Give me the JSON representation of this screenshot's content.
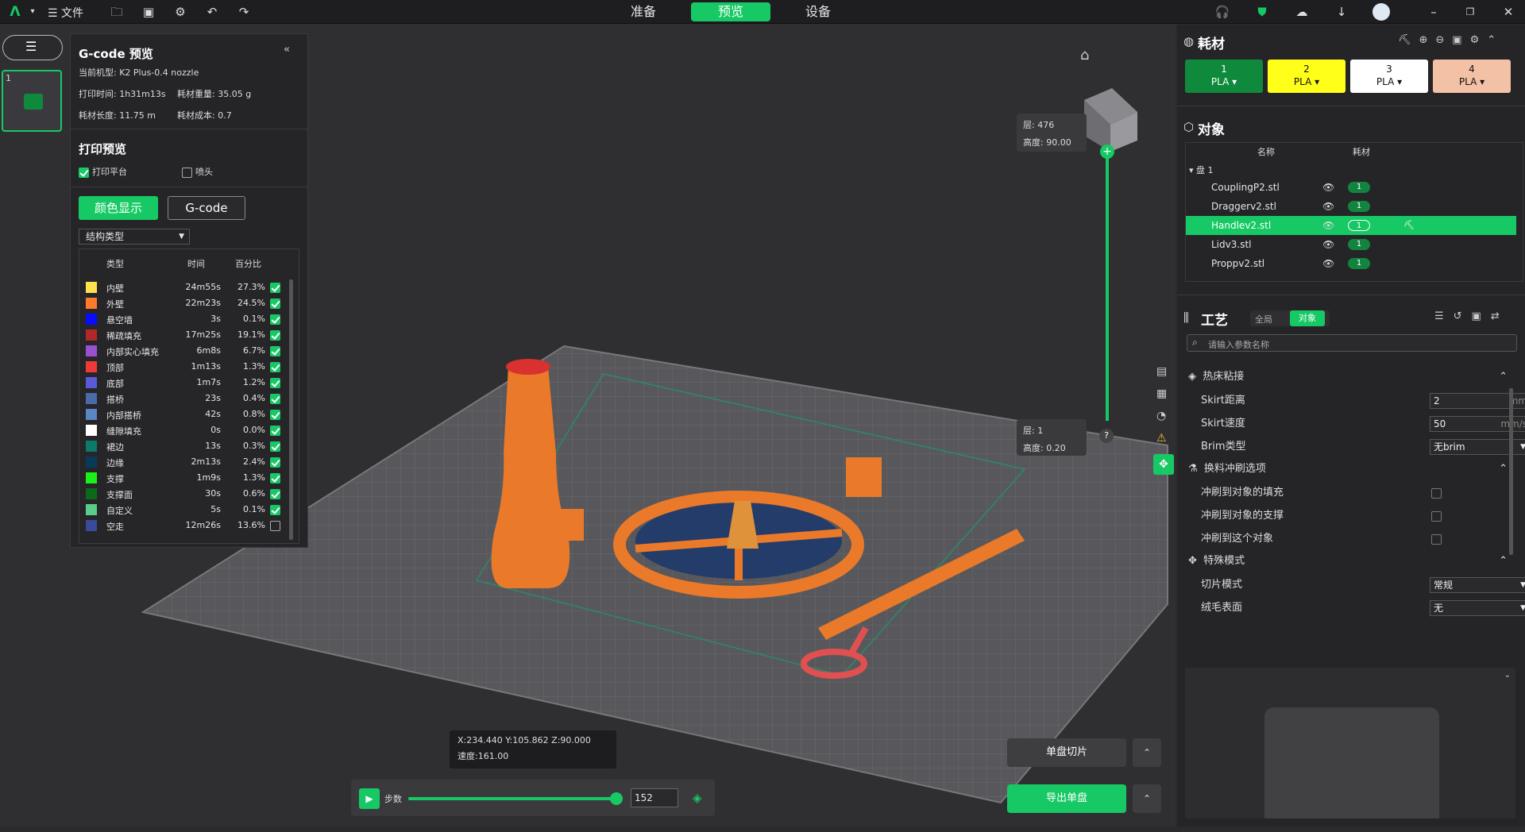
{
  "topbar": {
    "file_label": "文件",
    "tabs": [
      {
        "label": "准备"
      },
      {
        "label": "预览"
      },
      {
        "label": "设备"
      }
    ]
  },
  "thumbnail": {
    "index": "1"
  },
  "gcode_panel": {
    "title": "G-code 预览",
    "collapse": "«",
    "printer": "当前机型: K2 Plus-0.4 nozzle",
    "print_time": "打印时间: 1h31m13s",
    "filament_weight": "耗材重量: 35.05 g",
    "filament_length": "耗材长度: 11.75 m",
    "filament_cost": "耗材成本: 0.7",
    "preview_title": "打印预览",
    "opt_bed": "打印平台",
    "opt_nozzle": "喷头",
    "btn_color": "颜色显示",
    "btn_gcode": "G-code",
    "dropdown": "结构类型",
    "col_type": "类型",
    "col_time": "时间",
    "col_pct": "百分比",
    "rows": [
      {
        "name": "内壁",
        "time": "24m55s",
        "pct": "27.3%",
        "color": "#ffe14d",
        "checked": true
      },
      {
        "name": "外壁",
        "time": "22m23s",
        "pct": "24.5%",
        "color": "#ff7a2a",
        "checked": true
      },
      {
        "name": "悬空墙",
        "time": "3s",
        "pct": "0.1%",
        "color": "#0a0aff",
        "checked": true
      },
      {
        "name": "稀疏填充",
        "time": "17m25s",
        "pct": "19.1%",
        "color": "#b0282a",
        "checked": true
      },
      {
        "name": "内部实心填充",
        "time": "6m8s",
        "pct": "6.7%",
        "color": "#9a4fd0",
        "checked": true
      },
      {
        "name": "顶部",
        "time": "1m13s",
        "pct": "1.3%",
        "color": "#f03a3a",
        "checked": true
      },
      {
        "name": "底部",
        "time": "1m7s",
        "pct": "1.2%",
        "color": "#5a5ad8",
        "checked": true
      },
      {
        "name": "搭桥",
        "time": "23s",
        "pct": "0.4%",
        "color": "#4a6aa8",
        "checked": true
      },
      {
        "name": "内部搭桥",
        "time": "42s",
        "pct": "0.8%",
        "color": "#5b86c4",
        "checked": true
      },
      {
        "name": "缝隙填充",
        "time": "0s",
        "pct": "0.0%",
        "color": "#ffffff",
        "checked": true
      },
      {
        "name": "裙边",
        "time": "13s",
        "pct": "0.3%",
        "color": "#0a7a6a",
        "checked": true
      },
      {
        "name": "边缘",
        "time": "2m13s",
        "pct": "2.4%",
        "color": "#0a3a5a",
        "checked": true
      },
      {
        "name": "支撑",
        "time": "1m9s",
        "pct": "1.3%",
        "color": "#1af01a",
        "checked": true
      },
      {
        "name": "支撑面",
        "time": "30s",
        "pct": "0.6%",
        "color": "#0a6a1a",
        "checked": true
      },
      {
        "name": "自定义",
        "time": "5s",
        "pct": "0.1%",
        "color": "#5acc8a",
        "checked": true
      },
      {
        "name": "空走",
        "time": "12m26s",
        "pct": "13.6%",
        "color": "#3a4a9a",
        "checked": false
      }
    ]
  },
  "layer_slider": {
    "top_layer": "层: 476",
    "top_height": "高度: 90.00",
    "bottom_layer": "层: 1",
    "bottom_height": "高度: 0.20",
    "help": "?"
  },
  "coords": {
    "xyz": "X:234.440  Y:105.862  Z:90.000",
    "speed": "速度:161.00"
  },
  "playbar": {
    "steps_label": "步数",
    "step_value": "152",
    "progress": 0.97
  },
  "actions": {
    "slice": "单盘切片",
    "export": "导出单盘"
  },
  "right_panel": {
    "filament_title": "耗材",
    "filaments": [
      {
        "num": "1",
        "type": "PLA",
        "color": "#0f8a3c",
        "text": "#ffffff"
      },
      {
        "num": "2",
        "type": "PLA",
        "color": "#ffff1a",
        "text": "#111111"
      },
      {
        "num": "3",
        "type": "PLA",
        "color": "#ffffff",
        "text": "#111111"
      },
      {
        "num": "4",
        "type": "PLA",
        "color": "#f3c1a6",
        "text": "#111111"
      }
    ],
    "objects_title": "对象",
    "col_name": "名称",
    "col_filament": "耗材",
    "plate": "盘 1",
    "objects": [
      {
        "name": "CouplingP2.stl",
        "filament": "1"
      },
      {
        "name": "Draggerv2.stl",
        "filament": "1"
      },
      {
        "name": "Handlev2.stl",
        "filament": "1"
      },
      {
        "name": "Lidv3.stl",
        "filament": "1"
      },
      {
        "name": "Proppv2.stl",
        "filament": "1"
      }
    ],
    "process_title": "工艺",
    "toggle_global": "全局",
    "toggle_object": "对象",
    "search_placeholder": "请输入参数名称",
    "groups": {
      "bed_adhesion": "热床粘接",
      "purge": "换料冲刷选项",
      "special": "特殊模式"
    },
    "params": {
      "skirt_distance_label": "Skirt距离",
      "skirt_distance": "2",
      "skirt_distance_unit": "mm",
      "skirt_speed_label": "Skirt速度",
      "skirt_speed": "50",
      "skirt_speed_unit": "mm/s",
      "brim_label": "Brim类型",
      "brim": "无brim",
      "flush_infill": "冲刷到对象的填充",
      "flush_support": "冲刷到对象的支撑",
      "flush_object": "冲刷到这个对象",
      "slice_mode_label": "切片模式",
      "slice_mode": "常规",
      "fuzzy_label": "绒毛表面",
      "fuzzy": "无"
    }
  }
}
